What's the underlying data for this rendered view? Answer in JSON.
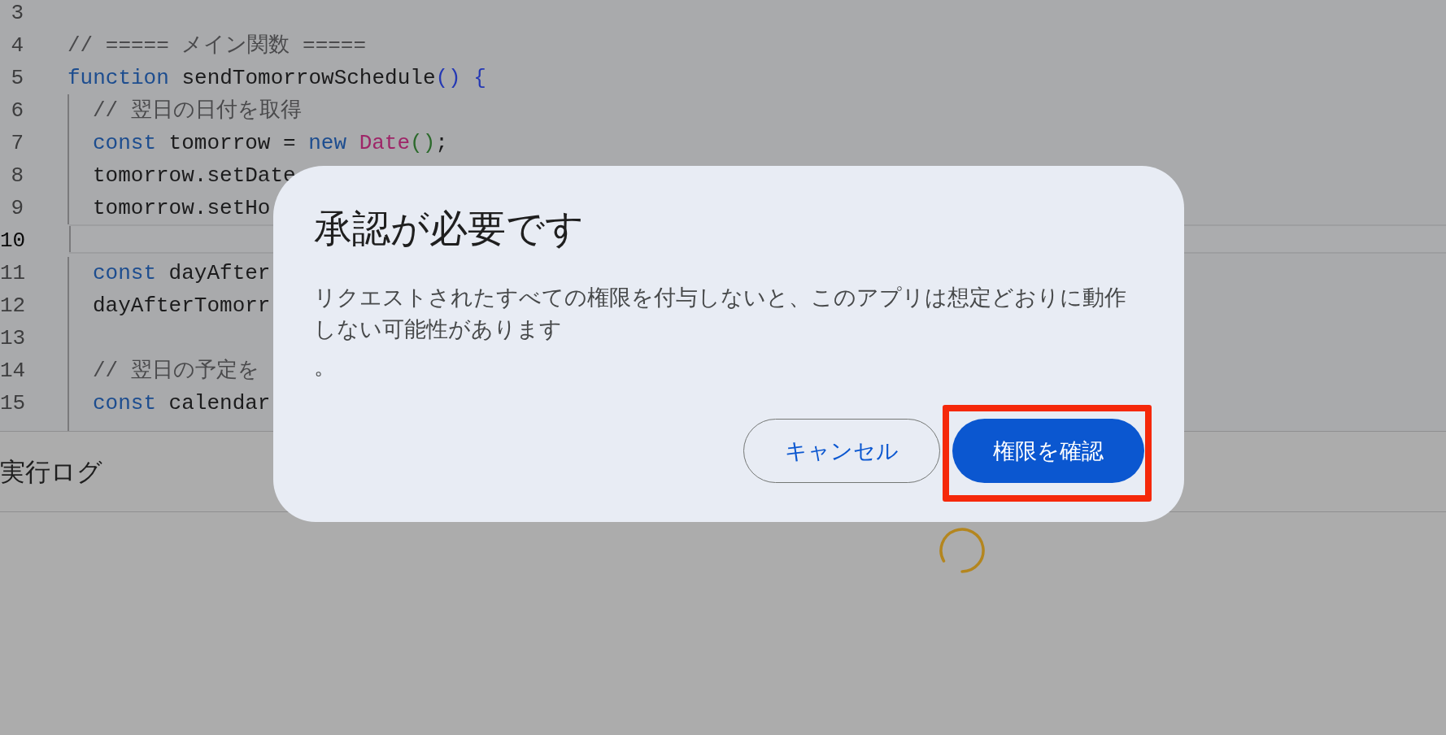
{
  "editor": {
    "lines": [
      {
        "number": "3",
        "current": false
      },
      {
        "number": "4",
        "current": false,
        "tokens": [
          {
            "kind": "comment",
            "text": "// ===== メイン関数 ====="
          }
        ]
      },
      {
        "number": "5",
        "current": false,
        "tokens": [
          {
            "kind": "keyword",
            "text": "function"
          },
          {
            "kind": "plain",
            "text": " sendTomorrowSchedule"
          },
          {
            "kind": "bracket",
            "text": "()"
          },
          {
            "kind": "bracket",
            "text": " {"
          }
        ],
        "children": [
          {
            "number": "6",
            "current": false,
            "tokens": [
              {
                "kind": "comment",
                "text": "// 翌日の日付を取得"
              }
            ]
          },
          {
            "number": "7",
            "current": false,
            "tokens": [
              {
                "kind": "keyword",
                "text": "const"
              },
              {
                "kind": "plain",
                "text": " tomorrow = "
              },
              {
                "kind": "keyword",
                "text": "new"
              },
              {
                "kind": "class",
                "text": " Date"
              },
              {
                "kind": "bracket-nested",
                "text": "()"
              },
              {
                "kind": "plain",
                "text": ";"
              }
            ]
          },
          {
            "number": "8",
            "current": false,
            "tokens": [
              {
                "kind": "plain",
                "text": "tomorrow.setDate"
              }
            ]
          },
          {
            "number": "9",
            "current": false,
            "tokens": [
              {
                "kind": "plain",
                "text": "tomorrow.setHo"
              }
            ]
          },
          {
            "number": "10",
            "current": true
          },
          {
            "number": "11",
            "current": false,
            "tokens": [
              {
                "kind": "keyword",
                "text": "const"
              },
              {
                "kind": "plain",
                "text": " dayAfter"
              }
            ]
          },
          {
            "number": "12",
            "current": false,
            "tokens": [
              {
                "kind": "plain",
                "text": "dayAfterTomorr"
              }
            ]
          },
          {
            "number": "13",
            "current": false
          },
          {
            "number": "14",
            "current": false,
            "tokens": [
              {
                "kind": "comment",
                "text": "// 翌日の予定を"
              }
            ]
          },
          {
            "number": "15",
            "current": false,
            "tokens": [
              {
                "kind": "keyword",
                "text": "const"
              },
              {
                "kind": "plain",
                "text": " calendar"
              }
            ]
          }
        ]
      }
    ]
  },
  "log_panel": {
    "title": "実行ログ",
    "loading": true
  },
  "dialog": {
    "title": "承認が必要です",
    "message": [
      "リクエストされたすべての権限を付与しないと、このアプリは想定どおりに動作しない可能性があります",
      "。"
    ],
    "buttons": [
      {
        "label": "キャンセル",
        "kind": "outlined",
        "highlighted": false
      },
      {
        "label": "権限を確認",
        "kind": "filled",
        "highlighted": true
      }
    ]
  }
}
